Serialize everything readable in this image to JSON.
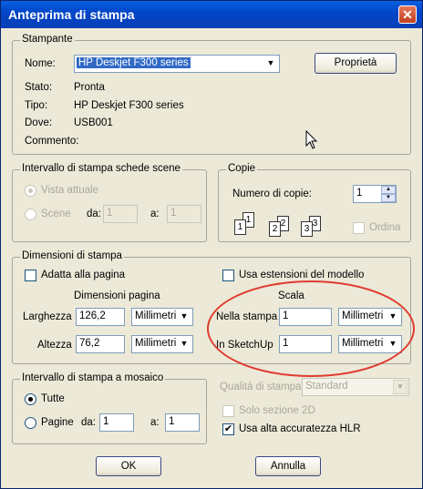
{
  "window": {
    "title": "Anteprima di stampa",
    "close_glyph": "✕"
  },
  "printer": {
    "legend": "Stampante",
    "name_label": "Nome:",
    "name_value": "HP Deskjet F300 series",
    "properties_button": "Proprietà",
    "status_label": "Stato:",
    "status_value": "Pronta",
    "type_label": "Tipo:",
    "type_value": "HP Deskjet F300 series",
    "where_label": "Dove:",
    "where_value": "USB001",
    "comment_label": "Commento:"
  },
  "range": {
    "legend": "Intervallo di stampa schede scene",
    "current_view": "Vista attuale",
    "scenes": "Scene",
    "from_label": "da:",
    "from_value": "1",
    "to_label": "a:",
    "to_value": "1"
  },
  "copies": {
    "legend": "Copie",
    "count_label": "Numero di copie:",
    "count_value": "1",
    "collate_label": "Ordina",
    "collate_pages": [
      "1",
      "1",
      "2",
      "2",
      "3",
      "3"
    ]
  },
  "dimensions": {
    "legend": "Dimensioni di stampa",
    "fit_page": "Adatta alla pagina",
    "use_model_extents": "Usa estensioni del modello",
    "page_dims_header": "Dimensioni pagina",
    "scale_header": "Scala",
    "width_label": "Larghezza",
    "width_value": "126,2",
    "width_unit": "Millimetri",
    "height_label": "Altezza",
    "height_value": "76,2",
    "height_unit": "Millimetri",
    "in_print_label": "Nella stampa",
    "in_print_value": "1",
    "in_print_unit": "Millimetri",
    "in_sketchup_label": "In SketchUp",
    "in_sketchup_value": "1",
    "in_sketchup_unit": "Millimetri"
  },
  "tiled": {
    "legend": "Intervallo di stampa a mosaico",
    "all": "Tutte",
    "pages": "Pagine",
    "from_label": "da:",
    "from_value": "1",
    "to_label": "a:",
    "to_value": "1"
  },
  "quality": {
    "label": "Qualità di stampa",
    "value": "Standard",
    "only_2d": "Solo sezione 2D",
    "hlr": "Usa alta accuratezza HLR"
  },
  "footer": {
    "ok": "OK",
    "cancel": "Annulla"
  },
  "colors": {
    "annotation_ellipse": "#e03b2f",
    "title_bar": "#0047c8"
  }
}
